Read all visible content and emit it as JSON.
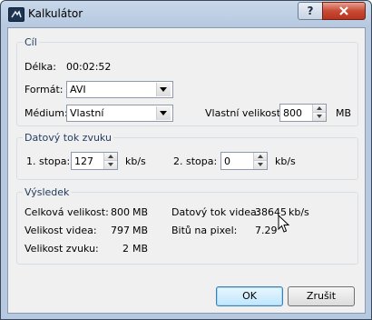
{
  "window": {
    "title": "Kalkulátor",
    "help": "?"
  },
  "cil": {
    "title": "Cíl",
    "delka_label": "Délka:",
    "delka_value": "00:02:52",
    "format_label": "Formát:",
    "format_value": "AVI",
    "medium_label": "Médium:",
    "medium_value": "Vlastní",
    "vlastni_label": "Vlastní velikost:",
    "vlastni_value": "800",
    "vlastni_unit": "MB"
  },
  "audio": {
    "title": "Datový tok zvuku",
    "track1_label": "1. stopa:",
    "track1_value": "127",
    "track1_unit": "kb/s",
    "track2_label": "2. stopa:",
    "track2_value": "0",
    "track2_unit": "kb/s"
  },
  "result": {
    "title": "Výsledek",
    "total_label": "Celková velikost:",
    "total_value": "800",
    "total_unit": "MB",
    "video_label": "Velikost videa:",
    "video_value": "797",
    "video_unit": "MB",
    "audio_label": "Velikost zvuku:",
    "audio_value": "2",
    "audio_unit": "MB",
    "bitrate_label": "Datový tok videa:",
    "bitrate_value": "38645",
    "bitrate_unit": "kb/s",
    "bpp_label": "Bitů na pixel:",
    "bpp_value": "7.29"
  },
  "buttons": {
    "ok": "OK",
    "cancel": "Zrušit"
  }
}
